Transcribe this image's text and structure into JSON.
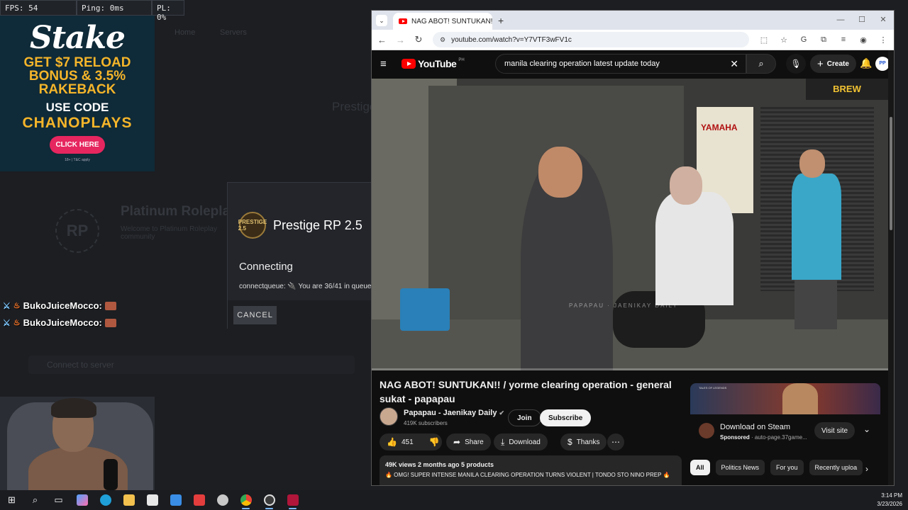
{
  "hud": {
    "fps": "FPS: 54",
    "ping": "Ping: 0ms",
    "pl": "PL: 0%"
  },
  "stake_ad": {
    "logo": "Stake",
    "line1": "GET $7 RELOAD",
    "line2": "BONUS & 3.5%",
    "line3": "RAKEBACK",
    "use_code": "USE CODE",
    "code": "CHANOPLAYS",
    "button": "CLICK HERE",
    "fine_print": "18+ | T&C apply"
  },
  "background_launcher": {
    "menu1": "Home",
    "menu2": "Servers",
    "server_name_ghost": "Platinum Roleplay",
    "server_desc_ghost": "Welcome to Platinum Roleplay community",
    "prestige_ghost": "Prestige",
    "search_ghost": "Connect to server",
    "logo_ghost": "RP"
  },
  "chat": [
    {
      "user": "BukoJuiceMocco:"
    },
    {
      "user": "BukoJuiceMocco:"
    }
  ],
  "dialog": {
    "logo_text": "PRESTIGE 2.5",
    "server_name": "Prestige RP 2.5",
    "status": "Connecting",
    "queue": "connectqueue: 🔌 You are 36/41 in queue",
    "cancel": "CANCEL"
  },
  "browser": {
    "tab_title": "NAG ABOT! SUNTUKAN!! /",
    "url": "youtube.com/watch?v=Y7VTF3wFV1c"
  },
  "youtube": {
    "logo": "YouTube",
    "country": "PH",
    "search_value": "manila clearing operation latest update today",
    "create": "Create",
    "avatar": "PP",
    "sign": "BREW",
    "banner": "YAMAHA",
    "watermark": "PAPAPAU · JAENIKAY DAILY",
    "video_title": "NAG ABOT! SUNTUKAN!! / yorme clearing operation - general sukat - papapau",
    "channel_name": "Papapau - Jaenikay Daily",
    "subscribers": "419K subscribers",
    "join": "Join",
    "subscribe": "Subscribe",
    "likes": "451",
    "share": "Share",
    "download": "Download",
    "thanks": "Thanks",
    "views_line": "49K views  2 months ago  5 products",
    "description": "🔥 OMG! SUPER INTENSE MANILA CLEARING OPERATION TURNS VIOLENT | TONDO STO NINO PREP 🔥",
    "ad_title": "Download on Steam",
    "ad_sponsored": "Sponsored",
    "ad_domain": "· auto-page.37game...",
    "ad_banner_label": "TALES OF LEGENDS",
    "visit_site": "Visit site",
    "chips": [
      "All",
      "Politics News",
      "For you",
      "Recently uploa"
    ]
  },
  "clock": {
    "time": "3:14 PM",
    "date": "3/23/2026"
  },
  "colors": {
    "youtube_red": "#ff0000",
    "stake_gold": "#f5b52a",
    "stake_pink": "#e6265f",
    "launcher_bg": "#1c1e22"
  }
}
